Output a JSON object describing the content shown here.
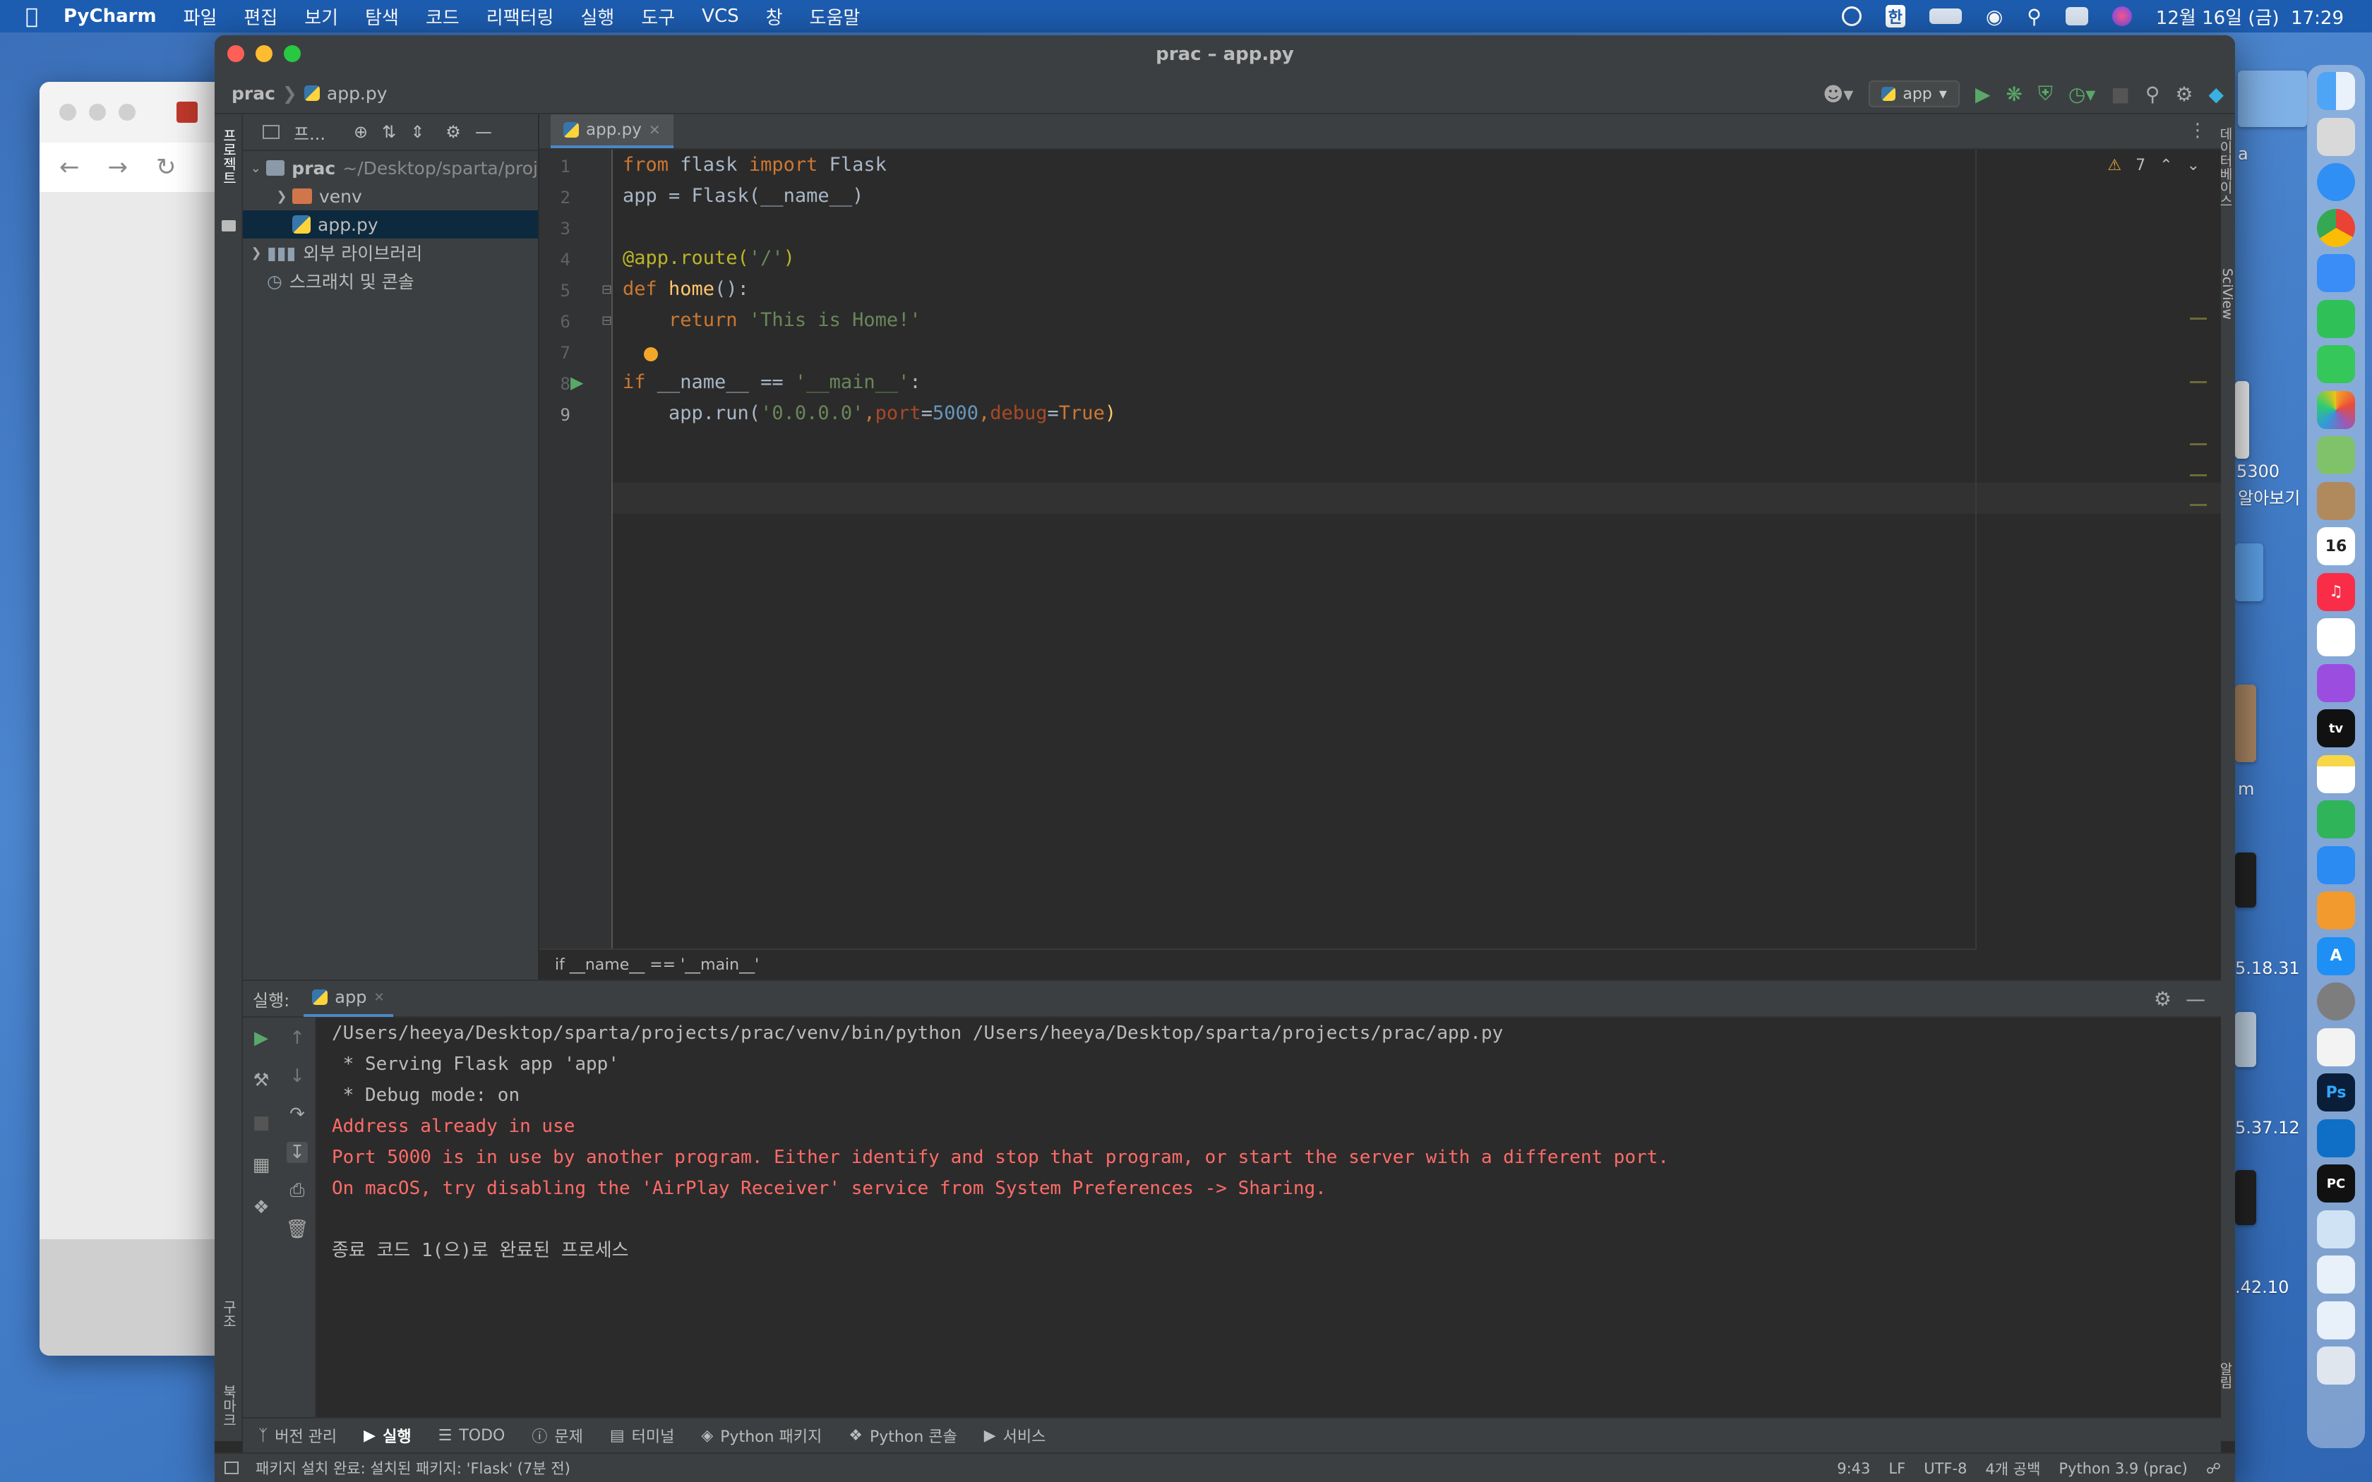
{
  "menubar": {
    "app_name": "PyCharm",
    "items": [
      "파일",
      "편집",
      "보기",
      "탐색",
      "코드",
      "리팩터링",
      "실행",
      "도구",
      "VCS",
      "창",
      "도움말"
    ],
    "datetime": "12월 16일 (금)  17:29",
    "input_source": "한"
  },
  "window": {
    "title": "prac – app.py",
    "breadcrumb_project": "prac",
    "breadcrumb_file": "app.py",
    "run_config": "app"
  },
  "sidebar": {
    "left_tool_label": "프로젝트",
    "structure_label": "구조",
    "bookmarks_label": "북마크"
  },
  "project": {
    "header": "프...",
    "tree": [
      {
        "label": "prac",
        "path": "~/Desktop/sparta/proj",
        "level": 0,
        "expanded": true,
        "kind": "folder"
      },
      {
        "label": "venv",
        "level": 1,
        "expanded": false,
        "kind": "folder-excluded"
      },
      {
        "label": "app.py",
        "level": 1,
        "kind": "python",
        "selected": true
      },
      {
        "label": "외부 라이브러리",
        "level": 0,
        "expanded": false,
        "kind": "library"
      },
      {
        "label": "스크래치 및 콘솔",
        "level": 0,
        "kind": "scratch"
      }
    ]
  },
  "editor": {
    "tab_label": "app.py",
    "warning_count": "7",
    "line_numbers": [
      "1",
      "2",
      "3",
      "4",
      "5",
      "6",
      "7",
      "8",
      "9"
    ],
    "breadcrumb": "if __name__ == '__main__'",
    "lines": [
      [
        {
          "t": "from ",
          "c": "kw"
        },
        {
          "t": "flask ",
          "c": ""
        },
        {
          "t": "import ",
          "c": "kw"
        },
        {
          "t": "Flask",
          "c": ""
        }
      ],
      [
        {
          "t": "app = Flask(__name__)",
          "c": ""
        }
      ],
      [],
      [
        {
          "t": "@app.route(",
          "c": "dec"
        },
        {
          "t": "'/'",
          "c": "str"
        },
        {
          "t": ")",
          "c": "dec"
        }
      ],
      [
        {
          "t": "def ",
          "c": "kw"
        },
        {
          "t": "home",
          "c": "fn"
        },
        {
          "t": "():",
          "c": ""
        }
      ],
      [
        {
          "t": "    return ",
          "c": "kw"
        },
        {
          "t": "'This is Home!'",
          "c": "str"
        }
      ],
      [],
      [
        {
          "t": "if ",
          "c": "kw"
        },
        {
          "t": "__name__ == ",
          "c": ""
        },
        {
          "t": "'__main__'",
          "c": "str"
        },
        {
          "t": ":",
          "c": ""
        }
      ],
      [
        {
          "t": "    app.run(",
          "c": ""
        },
        {
          "t": "'0.0.0.0'",
          "c": "str"
        },
        {
          "t": ",",
          "c": "kw"
        },
        {
          "t": "port",
          "c": "pn"
        },
        {
          "t": "=",
          "c": ""
        },
        {
          "t": "5000",
          "c": "num"
        },
        {
          "t": ",",
          "c": "kw"
        },
        {
          "t": "debug",
          "c": "pn"
        },
        {
          "t": "=",
          "c": ""
        },
        {
          "t": "True",
          "c": "kw"
        },
        {
          "t": ")",
          "c": "fn"
        }
      ]
    ]
  },
  "right_tools": {
    "database": "데이터베이스",
    "sciview": "SciView",
    "notifications": "알림"
  },
  "run": {
    "label": "실행:",
    "tab": "app",
    "console": [
      {
        "text": "/Users/heeya/Desktop/sparta/projects/prac/venv/bin/python /Users/heeya/Desktop/sparta/projects/prac/app.py",
        "kind": "normal"
      },
      {
        "text": " * Serving Flask app 'app'",
        "kind": "normal"
      },
      {
        "text": " * Debug mode: on",
        "kind": "normal"
      },
      {
        "text": "Address already in use",
        "kind": "err"
      },
      {
        "text": "Port 5000 is in use by another program. Either identify and stop that program, or start the server with a different port.",
        "kind": "err"
      },
      {
        "text": "On macOS, try disabling the 'AirPlay Receiver' service from System Preferences -> Sharing.",
        "kind": "err"
      },
      {
        "text": "",
        "kind": "normal"
      },
      {
        "text": "종료 코드 1(으)로 완료된 프로세스",
        "kind": "normal"
      }
    ]
  },
  "bottom_tabs": [
    "버전 관리",
    "실행",
    "TODO",
    "문제",
    "터미널",
    "Python 패키지",
    "Python 콘솔",
    "서비스"
  ],
  "status": {
    "message": "패키지 설치 완료: 설치된 패키지: 'Flask' (7분 전)",
    "position": "9:43",
    "line_sep": "LF",
    "encoding": "UTF-8",
    "indent": "4개 공백",
    "interpreter": "Python 3.9 (prac)"
  },
  "desktop": {
    "labels": [
      "a",
      "5300",
      "알아보기",
      "m",
      "5.18.31",
      "5.37.12",
      ".42.10"
    ]
  },
  "dock": {
    "calendar_day": "16",
    "apps": [
      "finder",
      "launchpad",
      "safari",
      "chrome",
      "mail",
      "facetime",
      "messages",
      "photos",
      "maps",
      "contacts",
      "calendar",
      "music",
      "reminders",
      "podcasts",
      "apple-tv",
      "notes",
      "numbers",
      "keynote",
      "pages",
      "app-store",
      "system-preferences",
      "textedit",
      "photoshop",
      "vscode",
      "pycharm",
      "preview",
      "doc1",
      "doc2",
      "trash"
    ]
  }
}
